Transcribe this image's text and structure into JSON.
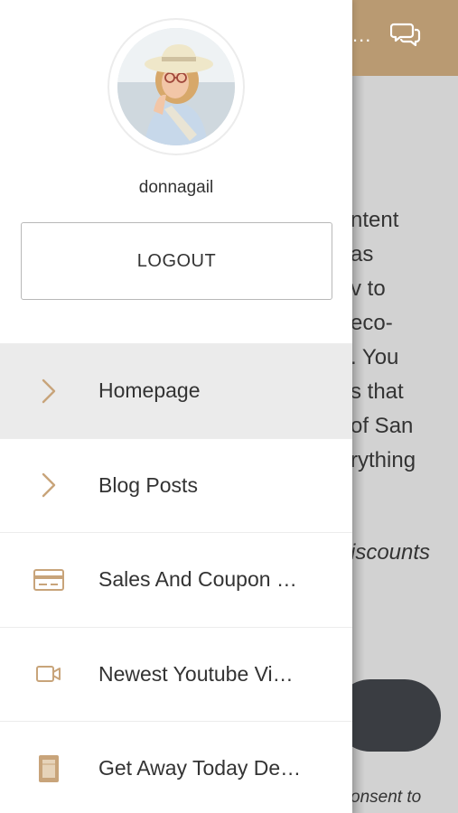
{
  "background": {
    "header_more": "...",
    "header_chat_icon": "chat-bubbles-icon",
    "lines": [
      "ntent",
      "as",
      "v to",
      "eco-",
      ". You",
      "s that",
      "of San",
      "rything"
    ],
    "italic_line": "iscounts",
    "footer_line": "onsent to"
  },
  "drawer": {
    "avatar_icon": "user-avatar",
    "username": "donnagail",
    "logout_label": "LOGOUT",
    "menu": [
      {
        "label": "Homepage",
        "icon": "chevron-right-icon",
        "active": true
      },
      {
        "label": "Blog Posts",
        "icon": "chevron-right-icon",
        "active": false
      },
      {
        "label": "Sales And Coupon …",
        "icon": "credit-card-icon",
        "active": false
      },
      {
        "label": "Newest Youtube Vi…",
        "icon": "video-camera-icon",
        "active": false
      },
      {
        "label": "Get Away Today De…",
        "icon": "book-icon",
        "active": false
      }
    ]
  },
  "colors": {
    "accent": "#c8a47a",
    "header": "#b99a72",
    "active_item": "#ebebeb"
  }
}
